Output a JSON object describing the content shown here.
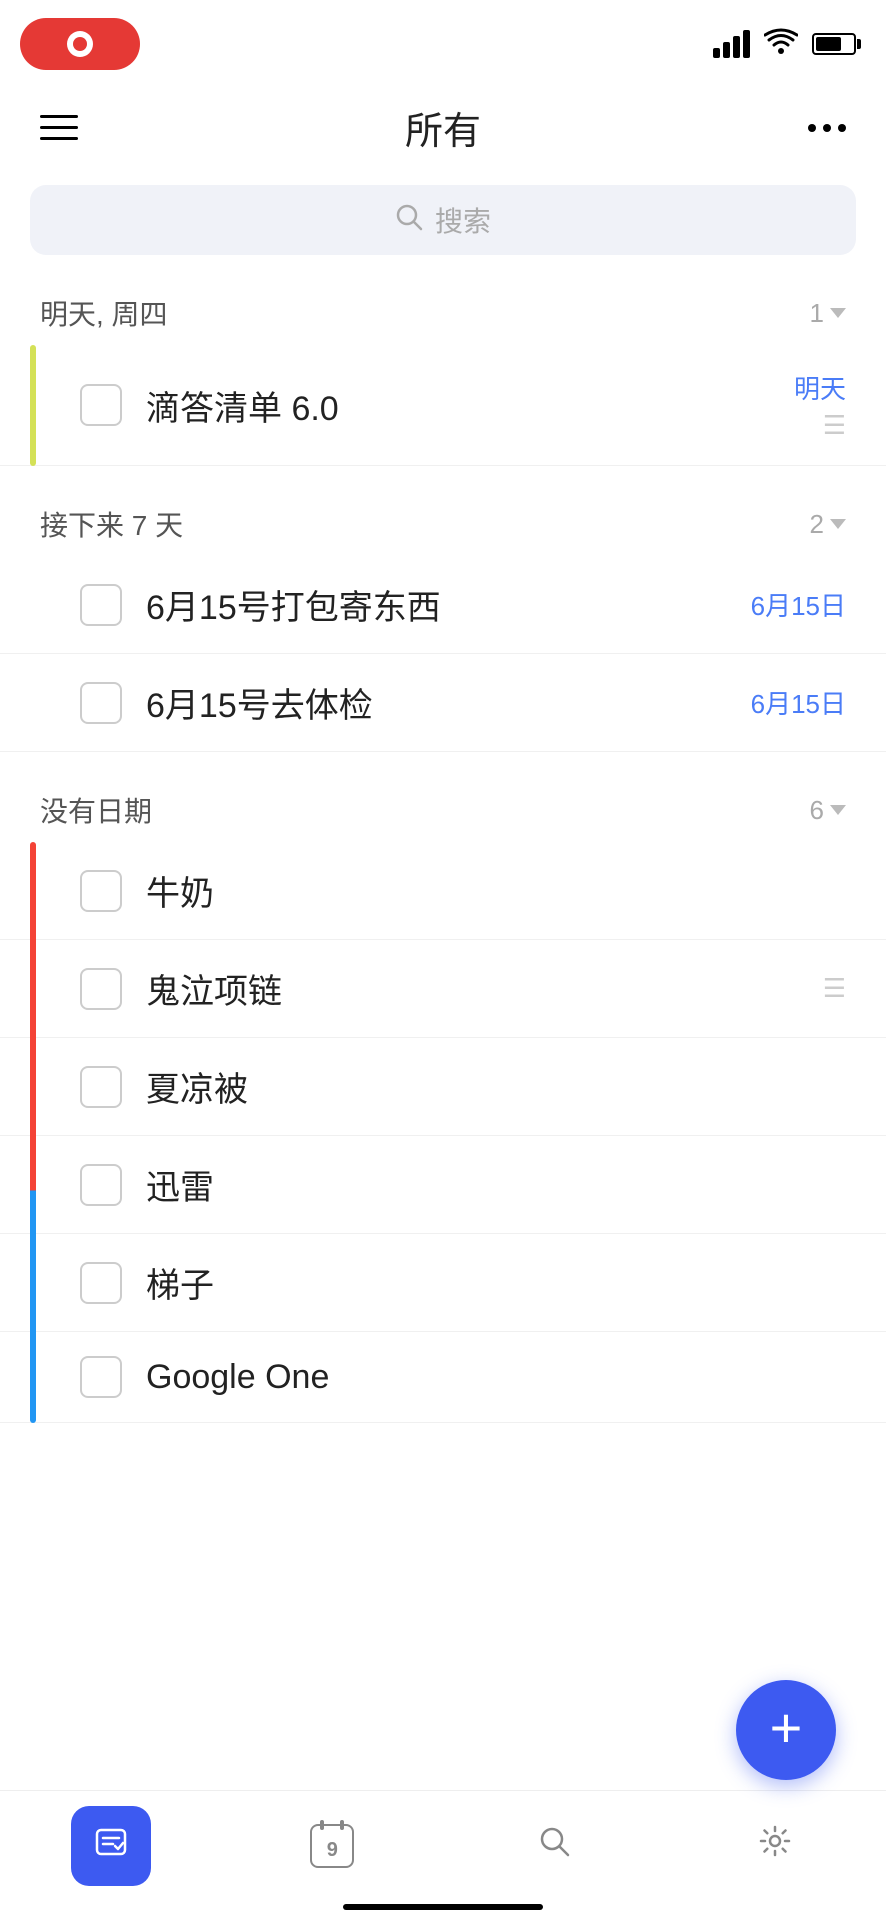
{
  "statusBar": {
    "recordLabel": "",
    "batteryLevel": 70
  },
  "header": {
    "title": "所有",
    "menuLabel": "菜单",
    "moreLabel": "更多"
  },
  "search": {
    "placeholder": "搜索"
  },
  "sections": [
    {
      "id": "tomorrow",
      "title": "明天, 周四",
      "count": "1",
      "colorBarClass": "color-bar-yellow",
      "tasks": [
        {
          "id": "task-1",
          "name": "滴答清单 6.0",
          "date": "明天",
          "hasNote": true,
          "checked": false
        }
      ]
    },
    {
      "id": "next7days",
      "title": "接下来 7 天",
      "count": "2",
      "colorBarClass": "",
      "tasks": [
        {
          "id": "task-2",
          "name": "6月15号打包寄东西",
          "date": "6月15日",
          "hasNote": false,
          "checked": false
        },
        {
          "id": "task-3",
          "name": "6月15号去体检",
          "date": "6月15日",
          "hasNote": false,
          "checked": false
        }
      ]
    },
    {
      "id": "nodate",
      "title": "没有日期",
      "count": "6",
      "colorBarClass": "color-bar-red-blue",
      "tasks": [
        {
          "id": "task-4",
          "name": "牛奶",
          "date": "",
          "hasNote": false,
          "checked": false
        },
        {
          "id": "task-5",
          "name": "鬼泣项链",
          "date": "",
          "hasNote": true,
          "checked": false
        },
        {
          "id": "task-6",
          "name": "夏凉被",
          "date": "",
          "hasNote": false,
          "checked": false
        },
        {
          "id": "task-7",
          "name": "迅雷",
          "date": "",
          "hasNote": false,
          "checked": false
        },
        {
          "id": "task-8",
          "name": "梯子",
          "date": "",
          "hasNote": false,
          "checked": false
        },
        {
          "id": "task-9",
          "name": "Google One",
          "date": "",
          "hasNote": false,
          "checked": false
        }
      ]
    }
  ],
  "bottomNav": [
    {
      "id": "tasks",
      "label": "任务",
      "icon": "✓",
      "active": true
    },
    {
      "id": "calendar",
      "label": "日历",
      "icon": "9",
      "active": false
    },
    {
      "id": "search",
      "label": "搜索",
      "icon": "⌕",
      "active": false
    },
    {
      "id": "settings",
      "label": "设置",
      "icon": "⚙",
      "active": false
    }
  ],
  "fab": {
    "label": "添加任务"
  }
}
